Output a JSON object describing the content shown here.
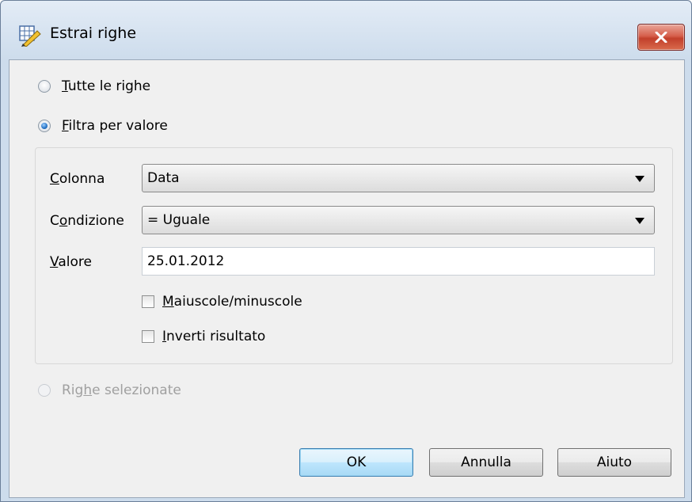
{
  "window": {
    "title": "Estrai righe",
    "icon": "table-edit-icon",
    "close_icon": "close-icon"
  },
  "mode": {
    "all_rows": {
      "prefix": "",
      "mnemonic": "T",
      "rest": "utte le righe",
      "selected": false
    },
    "filter_by_value": {
      "prefix": "",
      "mnemonic": "F",
      "rest": "iltra per valore",
      "selected": true
    },
    "selected_rows": {
      "prefix": "Rig",
      "mnemonic": "h",
      "rest": "e selezionate",
      "selected": false,
      "enabled": false
    }
  },
  "filter": {
    "column": {
      "label_mnemonic": "C",
      "label_rest": "olonna",
      "value": "Data"
    },
    "condition": {
      "label_prefix": "C",
      "label_mnemonic": "o",
      "label_rest": "ndizione",
      "value": "= Uguale"
    },
    "value": {
      "label_mnemonic": "V",
      "label_rest": "alore",
      "value": "25.01.2012"
    },
    "case_sensitive": {
      "mnemonic": "M",
      "rest": "aiuscole/minuscole",
      "checked": false
    },
    "invert_result": {
      "mnemonic": "I",
      "rest": "nverti risultato",
      "checked": false
    }
  },
  "buttons": {
    "ok": "OK",
    "cancel": "Annulla",
    "help": "Aiuto"
  }
}
